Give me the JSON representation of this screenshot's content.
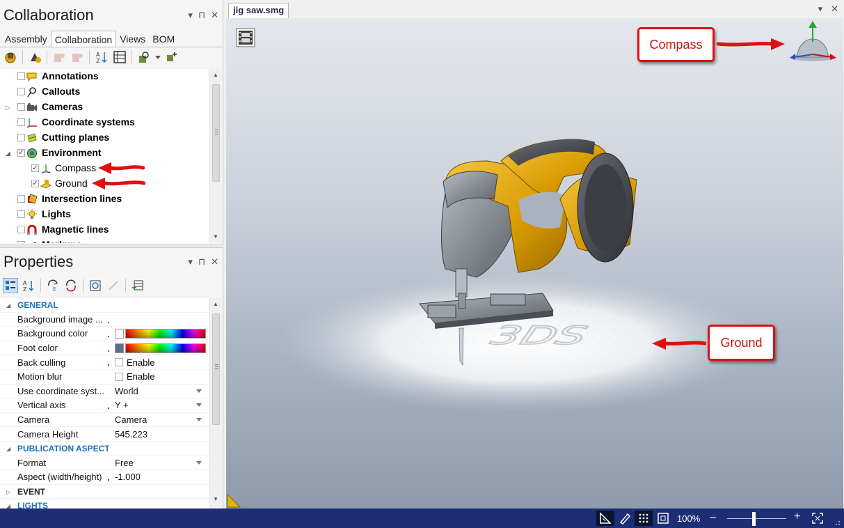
{
  "collab_panel": {
    "title": "Collaboration",
    "ctrls": [
      "▾",
      "⊓",
      "✕"
    ],
    "tabs": [
      "Assembly",
      "Collaboration",
      "Views",
      "BOM"
    ]
  },
  "tree": [
    {
      "label": "Annotations",
      "bold": true,
      "checked": false,
      "expander": "",
      "icon": "annotation-icon"
    },
    {
      "label": "Callouts",
      "bold": true,
      "checked": false,
      "expander": "",
      "icon": "callout-icon"
    },
    {
      "label": "Cameras",
      "bold": true,
      "checked": false,
      "expander": "▷",
      "icon": "camera-icon"
    },
    {
      "label": "Coordinate systems",
      "bold": true,
      "checked": false,
      "expander": "",
      "icon": "axes-icon"
    },
    {
      "label": "Cutting planes",
      "bold": true,
      "checked": false,
      "expander": "",
      "icon": "cutting-plane-icon"
    },
    {
      "label": "Environment",
      "bold": true,
      "checked": true,
      "expander": "◢",
      "icon": "environment-icon"
    },
    {
      "label": "Compass",
      "bold": false,
      "checked": true,
      "expander": "",
      "icon": "compass-icon",
      "child": true
    },
    {
      "label": "Ground",
      "bold": false,
      "checked": true,
      "expander": "",
      "icon": "ground-icon",
      "child": true
    },
    {
      "label": "Intersection lines",
      "bold": true,
      "checked": false,
      "expander": "",
      "icon": "intersection-icon"
    },
    {
      "label": "Lights",
      "bold": true,
      "checked": false,
      "expander": "",
      "icon": "light-icon"
    },
    {
      "label": "Magnetic lines",
      "bold": true,
      "checked": false,
      "expander": "",
      "icon": "magnet-icon"
    },
    {
      "label": "Markups",
      "bold": true,
      "checked": false,
      "expander": "",
      "icon": "markup-icon"
    }
  ],
  "props_panel": {
    "title": "Properties",
    "ctrls": [
      "▾",
      "⊓",
      "✕"
    ]
  },
  "props": {
    "general": "GENERAL",
    "background_image": "Background image ...",
    "background_color": "Background color",
    "foot_color": "Foot color",
    "back_culling": "Back culling",
    "back_culling_val": "Enable",
    "motion_blur": "Motion blur",
    "motion_blur_val": "Enable",
    "use_coord": "Use coordinate syst...",
    "use_coord_val": "World",
    "vertical_axis": "Vertical axis",
    "vertical_axis_val": "Y +",
    "camera": "Camera",
    "camera_val": "Camera",
    "camera_height": "Camera Height",
    "camera_height_val": "545.223",
    "publication": "PUBLICATION ASPECT",
    "format": "Format",
    "format_val": "Free",
    "aspect": "Aspect (width/height)",
    "aspect_val": "-1.000",
    "event": "EVENT",
    "lights": "LIGHTS"
  },
  "document": {
    "tab": "jig saw.smg",
    "ctrls": [
      "▾",
      "✕"
    ]
  },
  "callouts": {
    "compass": "Compass",
    "ground": "Ground"
  },
  "statusbar": {
    "zoom": "100%",
    "minus": "–",
    "plus": "+",
    "zoom_fraction": 0.45
  },
  "colors": {
    "accent": "#1e73be",
    "callout_red": "#e01010",
    "status_bg": "#1e2e74",
    "saw_yellow": "#e0a400",
    "saw_gray": "#8a8f96"
  }
}
